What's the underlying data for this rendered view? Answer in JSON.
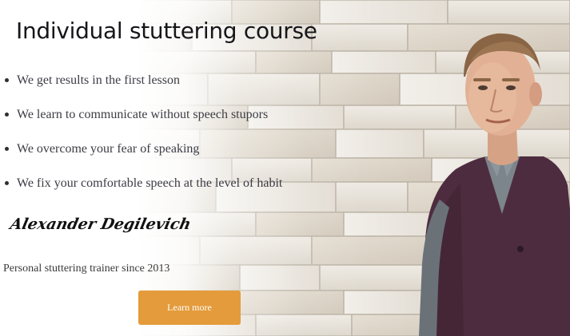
{
  "hero": {
    "title": "Individual stuttering course",
    "bullets": [
      "We get results in the first lesson",
      "We learn to communicate without speech stupors",
      "We overcome your fear of speaking",
      "We fix your comfortable speech at the level of habit"
    ],
    "signature": "Alexander Degilevich",
    "subtitle": "Personal stuttering trainer since 2013",
    "cta_label": "Learn more"
  },
  "colors": {
    "accent": "#e49b3b",
    "title": "#16161a",
    "body_text": "#3c3c44"
  }
}
